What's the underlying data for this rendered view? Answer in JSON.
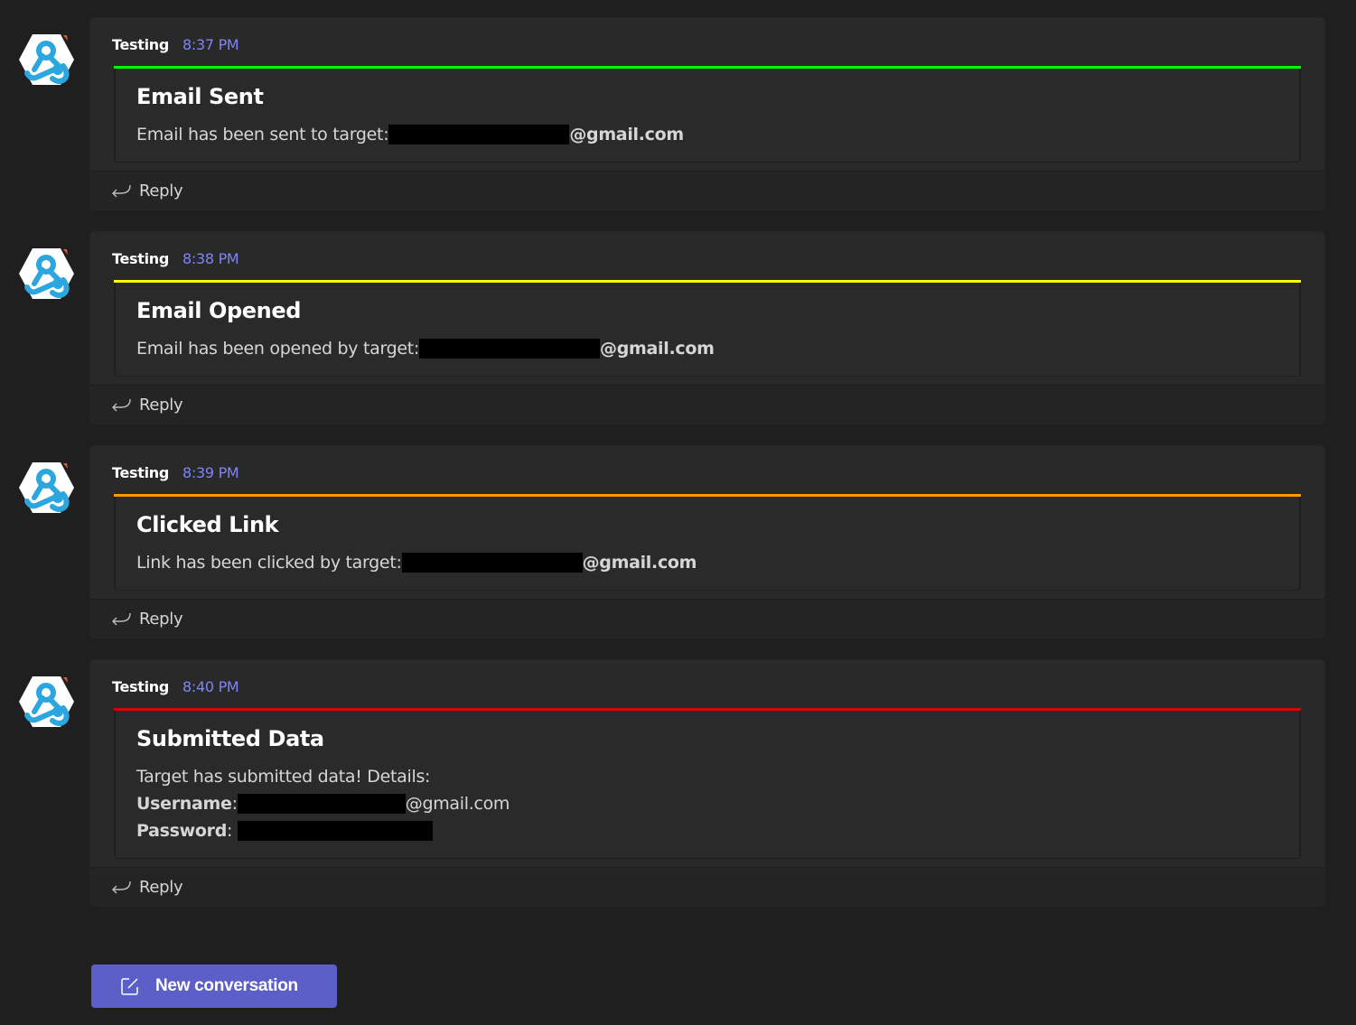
{
  "messages": [
    {
      "author": "Testing",
      "time": "8:37 PM",
      "accent_color": "#00ff00",
      "title": "Email Sent",
      "body_prefix": "Email has been sent to target:",
      "body_suffix": "@gmail.com",
      "reply_label": "Reply"
    },
    {
      "author": "Testing",
      "time": "8:38 PM",
      "accent_color": "#ffff00",
      "title": "Email Opened",
      "body_prefix": "Email has been opened by target:",
      "body_suffix": "@gmail.com",
      "reply_label": "Reply"
    },
    {
      "author": "Testing",
      "time": "8:39 PM",
      "accent_color": "#ff9900",
      "title": "Clicked Link",
      "body_prefix": "Link has been clicked by target:",
      "body_suffix": "@gmail.com",
      "reply_label": "Reply"
    },
    {
      "author": "Testing",
      "time": "8:40 PM",
      "accent_color": "#dd0000",
      "title": "Submitted Data",
      "intro": "Target has submitted data! Details:",
      "username_label": "Username",
      "username_suffix": "@gmail.com",
      "password_label": "Password",
      "colon": ":",
      "reply_label": "Reply"
    }
  ],
  "avatar_icon": "webhook-icon",
  "reply_icon": "reply-arrow-icon",
  "new_conversation": {
    "label": "New conversation",
    "icon": "compose-icon",
    "color": "#5b5fc7"
  }
}
